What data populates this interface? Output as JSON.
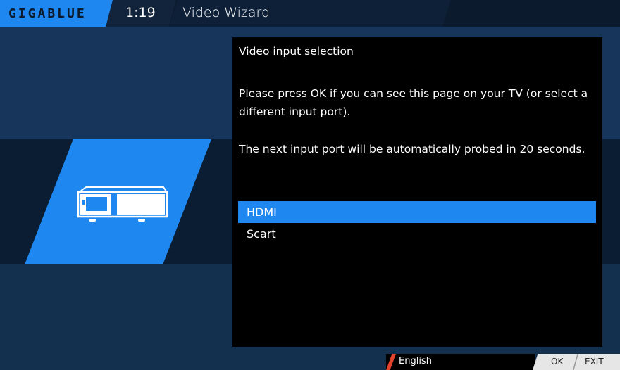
{
  "header": {
    "logo": "GIGABLUE",
    "time": "1:19",
    "title": "Video Wizard"
  },
  "content": {
    "heading": "Video input selection",
    "instruction": "Please press OK if you can see this page on your TV (or select a different input port).",
    "probe_notice": "The next input port will be automatically probed in 20 seconds.",
    "options": [
      {
        "label": "HDMI",
        "selected": true
      },
      {
        "label": "Scart",
        "selected": false
      }
    ]
  },
  "footer": {
    "language": "English",
    "key_ok": "OK",
    "key_exit": "EXIT"
  },
  "icons": {
    "device": "set-top-box-icon"
  },
  "colors": {
    "accent": "#1e88f0",
    "language_marker": "#e0442c",
    "background": "#132d4d"
  }
}
